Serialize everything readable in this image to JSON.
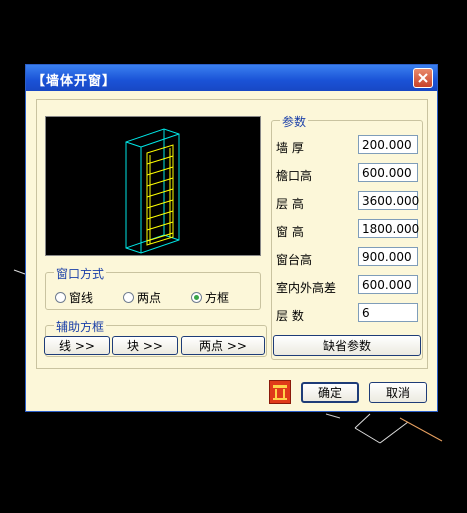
{
  "dialog": {
    "title": "【墙体开窗】",
    "close_label": "✕",
    "ok_label": "确定",
    "cancel_label": "取消"
  },
  "window_mode": {
    "label": "窗口方式",
    "options": [
      {
        "label": "窗线",
        "selected": false
      },
      {
        "label": "两点",
        "selected": false
      },
      {
        "label": "方框",
        "selected": true
      }
    ]
  },
  "aux_frame": {
    "label": "辅助方框",
    "buttons": [
      "线 >>",
      "块 >>",
      "两点 >>"
    ]
  },
  "params": {
    "label": "参数",
    "items": [
      {
        "label": "墙  厚",
        "value": "200.000"
      },
      {
        "label": "檐口高",
        "value": "600.000"
      },
      {
        "label": "层  高",
        "value": "3600.000"
      },
      {
        "label": "窗  高",
        "value": "1800.000"
      },
      {
        "label": "窗台高",
        "value": "900.000"
      },
      {
        "label": "室内外高差",
        "value": "600.000"
      },
      {
        "label": "层  数",
        "value": "6"
      }
    ],
    "default_button": "缺省参数"
  },
  "colors": {
    "titlebar": "#1a52d6",
    "dialog_bg": "#fcf7d9",
    "preview_cyan": "#00e5e5",
    "preview_yellow": "#ffff00"
  }
}
